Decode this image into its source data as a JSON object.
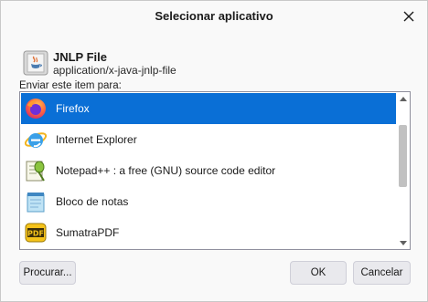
{
  "dialog": {
    "title": "Selecionar aplicativo",
    "close_icon": "close-icon"
  },
  "file": {
    "icon": "java-file-icon",
    "name": "JNLP File",
    "mime": "application/x-java-jnlp-file"
  },
  "send_label": "Enviar este item para:",
  "apps": [
    {
      "label": "Firefox",
      "icon": "firefox-icon",
      "selected": true
    },
    {
      "label": "Internet Explorer",
      "icon": "internet-explorer-icon",
      "selected": false
    },
    {
      "label": "Notepad++ : a free (GNU) source code editor",
      "icon": "notepad-plus-plus-icon",
      "selected": false
    },
    {
      "label": "Bloco de notas",
      "icon": "notepad-icon",
      "selected": false
    },
    {
      "label": "SumatraPDF",
      "icon": "pdf-icon",
      "selected": false
    }
  ],
  "buttons": {
    "browse": "Procurar...",
    "ok": "OK",
    "cancel": "Cancelar"
  },
  "colors": {
    "selection": "#0a6fd6",
    "button_bg": "#e9e9ed"
  }
}
